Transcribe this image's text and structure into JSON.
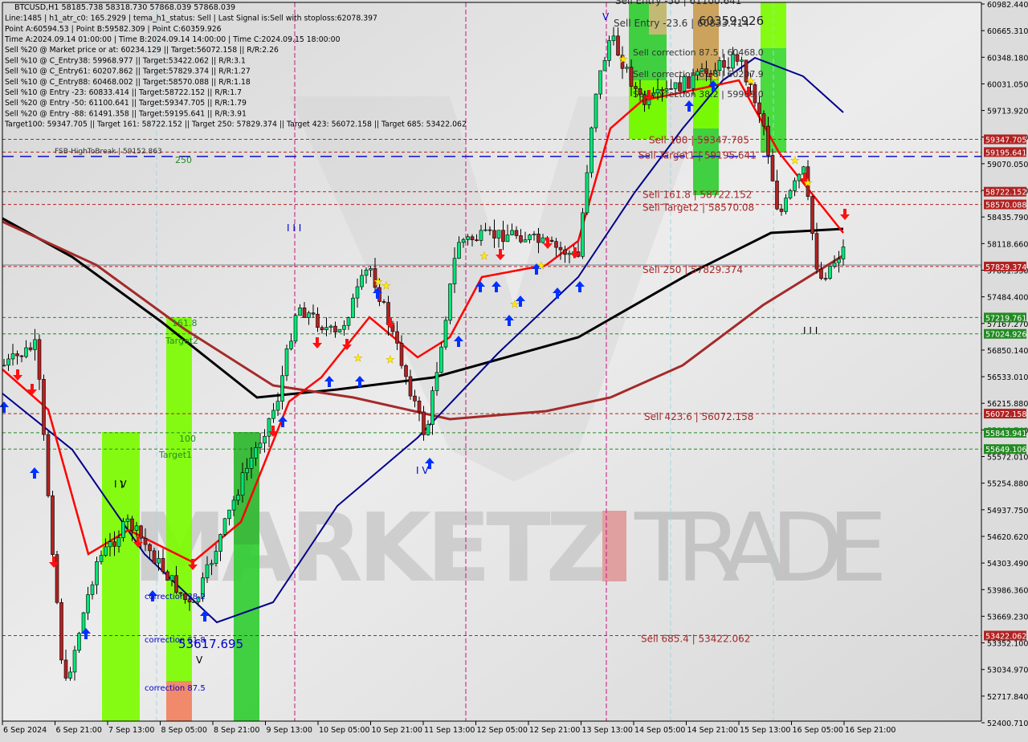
{
  "chart_data": {
    "type": "candlestick",
    "symbol": "BTCUSD",
    "timeframe": "H1",
    "ohlc_header": "BTCUSD,H1  58185.738 58318.730 57868.039 57868.039",
    "info_lines": [
      "Line:1485 | h1_atr_c0: 165.2929 | tema_h1_status: Sell | Last Signal is:Sell with stoploss:62078.397",
      "Point A:60594.53 | Point B:59582.309 | Point C:60359.926",
      "Time A:2024.09.14 01:00:00 | Time B:2024.09.14 14:00:00 | Time C:2024.09.15 18:00:00",
      "Sell %20 @ Market price or at: 60234.129 || Target:56072.158 || R/R:2.26",
      "Sell %10 @ C_Entry38: 59968.977 || Target:53422.062 || R/R:3.1",
      "Sell %10 @ C_Entry61: 60207.862 || Target:57829.374 || R/R:1.27",
      "Sell %10 @ C_Entry88: 60468.002 || Target:58570.088 || R/R:1.18",
      "Sell %10 @ Entry -23: 60833.414 || Target:58722.152 || R/R:1.7",
      "Sell %20 @ Entry -50: 61100.641 || Target:59347.705 || R/R:1.79",
      "Sell %20 @ Entry -88: 61491.358 || Target:59195.641 || R/R:3.91",
      "Target100: 59347.705 || Target 161: 58722.152 || Target 250: 57829.374 || Target 423: 56072.158 || Target 685: 53422.062"
    ],
    "ylim": [
      52400.71,
      60982.44
    ],
    "y_ticks": [
      "60982.440",
      "60665.310",
      "60348.180",
      "60031.050",
      "59713.920",
      "59397.190",
      "59070.050",
      "58752.920",
      "58435.790",
      "58118.660",
      "57801.530",
      "57484.400",
      "57167.270",
      "56850.140",
      "56533.010",
      "56215.880",
      "55898.740",
      "55572.010",
      "55254.880",
      "54937.750",
      "54620.620",
      "54303.490",
      "53986.360",
      "53669.230",
      "53352.100",
      "53034.970",
      "52717.840",
      "52400.710"
    ],
    "x_ticks": [
      "6 Sep 2024",
      "6 Sep 21:00",
      "7 Sep 13:00",
      "8 Sep 05:00",
      "8 Sep 21:00",
      "9 Sep 13:00",
      "10 Sep 05:00",
      "10 Sep 21:00",
      "11 Sep 13:00",
      "12 Sep 05:00",
      "12 Sep 21:00",
      "13 Sep 13:00",
      "14 Sep 05:00",
      "14 Sep 21:00",
      "15 Sep 13:00",
      "16 Sep 05:00",
      "16 Sep 21:00"
    ],
    "price_labels": [
      {
        "value": 59347.705,
        "text": "59347.705",
        "color": "#b22222"
      },
      {
        "value": 59195.641,
        "text": "59195.641",
        "color": "#b22222"
      },
      {
        "value": 58722.152,
        "text": "58722.152",
        "color": "#b22222"
      },
      {
        "value": 58570.088,
        "text": "58570.088",
        "color": "#b22222"
      },
      {
        "value": 57829.374,
        "text": "57829.374",
        "color": "#b22222"
      },
      {
        "value": 57219.761,
        "text": "57219.761",
        "color": "#228b22"
      },
      {
        "value": 57024.926,
        "text": "57024.926",
        "color": "#228b22"
      },
      {
        "value": 56072.158,
        "text": "56072.158",
        "color": "#b22222"
      },
      {
        "value": 55843.941,
        "text": "55843.941",
        "color": "#228b22"
      },
      {
        "value": 55649.106,
        "text": "55649.106",
        "color": "#228b22"
      },
      {
        "value": 53422.062,
        "text": "53422.062",
        "color": "#b22222"
      }
    ],
    "level_texts": [
      {
        "text": "Sell 100 | 59347.705",
        "value": 59347.705
      },
      {
        "text": "Sell Target1 | 59195.641",
        "value": 59195.641
      },
      {
        "text": "Sell 161.8 | 58722.152",
        "value": 58722.152
      },
      {
        "text": "Sell Target2 | 58570.08",
        "value": 58570.088
      },
      {
        "text": "Sell  250 | 57829.374",
        "value": 57829.374
      },
      {
        "text": "Sell  423.6 | 56072.158",
        "value": 56072.158
      },
      {
        "text": "Sell  685.4 | 53422.062",
        "value": 53422.062
      }
    ],
    "fsb_label": "FSB-HighToBreak | 59152.863",
    "fsb_value": 59152.863,
    "fib_labels": {
      "l250": "250",
      "l1618": "161.8",
      "target2": "Target2",
      "l100": "100",
      "target1": "Target1"
    },
    "correction_labels": [
      "correction 38.2",
      "correction 61.8",
      "correction 87.5"
    ],
    "point_c_label": "60359.926",
    "low_label": "53617.695",
    "sell_entry_label": "Sell Entry -23.6 | 60833.414",
    "sell_entry_top_label": "Sell Entry -50 | 61100.641",
    "sell_correction_labels": [
      "Sell correction 87.5 | 60468.0",
      "Sell correction 61.8 | 60207.9",
      "Sell correction 38.2 | 59969.0"
    ],
    "wave_labels": [
      "I I I",
      "I V",
      "I",
      "V",
      "I V",
      "V",
      "I I I"
    ],
    "watermark": {
      "left": "MARKETZ",
      "right": "TRADE"
    },
    "colors": {
      "bull": "#00e676",
      "bear": "#b22222",
      "ema_fast": "#ff0000",
      "ema_mid": "#00008b",
      "ma_black": "#000000",
      "ma_brown": "#a52a2a",
      "zone_green": "#7cfc00",
      "zone_dark": "#32cd32",
      "zone_red": "#fa8072"
    }
  }
}
